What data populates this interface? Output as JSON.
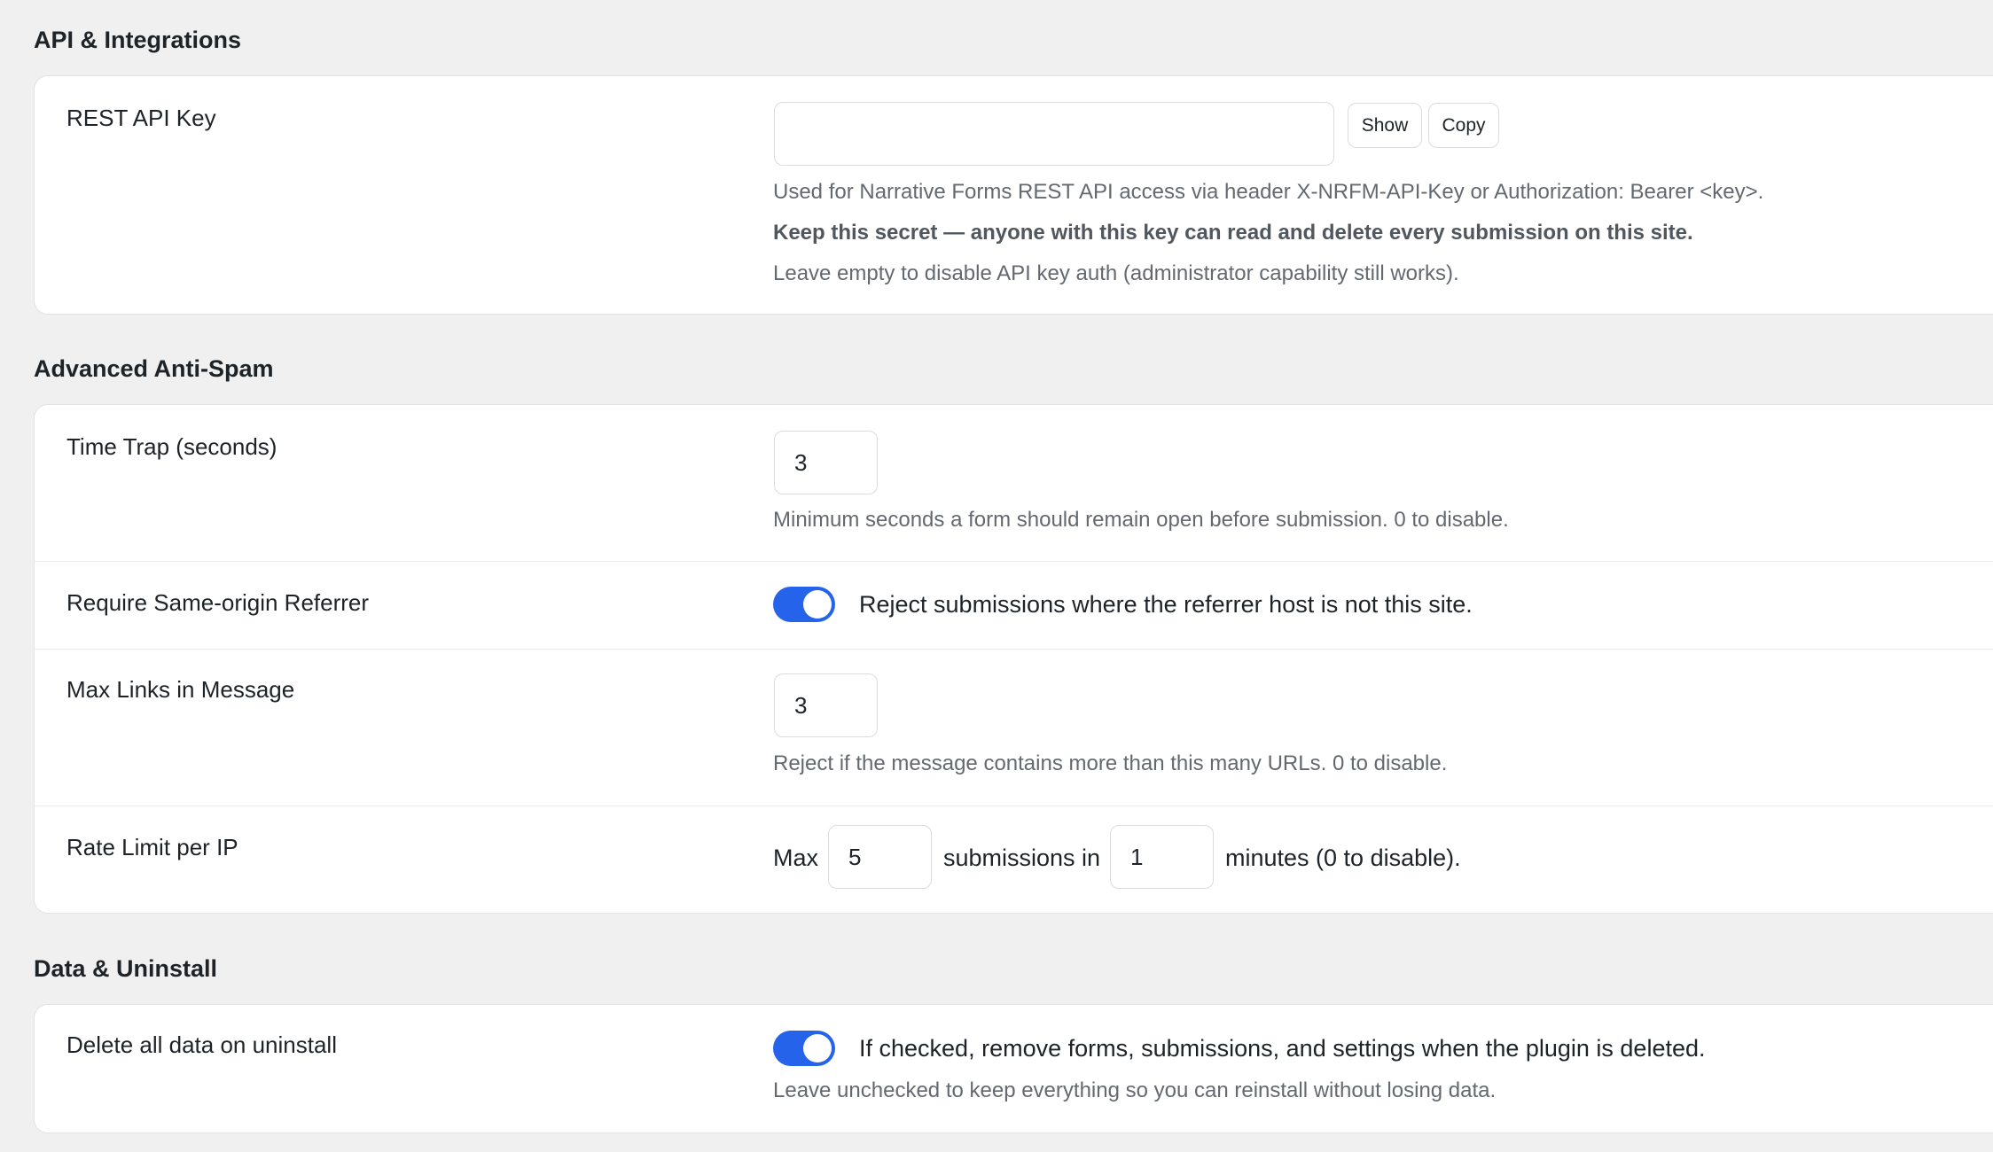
{
  "sections": {
    "api": {
      "title": "API & Integrations",
      "rest_api_key": {
        "label": "REST API Key",
        "value": "",
        "show_label": "Show",
        "copy_label": "Copy",
        "help1": "Used for Narrative Forms REST API access via header X-NRFM-API-Key or Authorization: Bearer <key>.",
        "help2": "Keep this secret — anyone with this key can read and delete every submission on this site.",
        "help3": "Leave empty to disable API key auth (administrator capability still works)."
      }
    },
    "antispam": {
      "title": "Advanced Anti-Spam",
      "time_trap": {
        "label": "Time Trap (seconds)",
        "value": "3",
        "help": "Minimum seconds a form should remain open before submission. 0 to disable."
      },
      "same_origin": {
        "label": "Require Same-origin Referrer",
        "checked": true,
        "text": "Reject submissions where the referrer host is not this site."
      },
      "max_links": {
        "label": "Max Links in Message",
        "value": "3",
        "help": "Reject if the message contains more than this many URLs. 0 to disable."
      },
      "rate_limit": {
        "label": "Rate Limit per IP",
        "prefix": "Max",
        "submissions_value": "5",
        "middle": "submissions in",
        "minutes_value": "1",
        "suffix": "minutes (0 to disable)."
      }
    },
    "data": {
      "title": "Data & Uninstall",
      "delete_on_uninstall": {
        "label": "Delete all data on uninstall",
        "checked": true,
        "text": "If checked, remove forms, submissions, and settings when the plugin is deleted.",
        "help": "Leave unchecked to keep everything so you can reinstall without losing data."
      }
    }
  },
  "colors": {
    "toggle_on": "#2563eb",
    "page_bg": "#f0f0f1",
    "card_bg": "#ffffff"
  }
}
